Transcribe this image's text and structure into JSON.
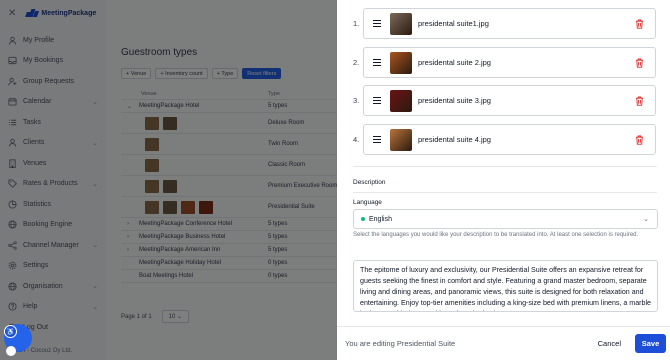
{
  "app": {
    "brand": "MeetingPackage",
    "close_icon": "close-icon"
  },
  "sidebar": {
    "items": [
      {
        "label": "My Profile",
        "icon": "user-icon",
        "expandable": false
      },
      {
        "label": "My Bookings",
        "icon": "inbox-icon",
        "expandable": false
      },
      {
        "label": "Group Requests",
        "icon": "add-user-icon",
        "expandable": false
      },
      {
        "label": "Calendar",
        "icon": "calendar-icon",
        "expandable": true
      },
      {
        "label": "Tasks",
        "icon": "list-icon",
        "expandable": false
      },
      {
        "label": "Clients",
        "icon": "user-icon",
        "expandable": true
      },
      {
        "label": "Venues",
        "icon": "building-icon",
        "expandable": false
      },
      {
        "label": "Rates & Products",
        "icon": "tag-icon",
        "expandable": true
      },
      {
        "label": "Statistics",
        "icon": "pie-chart-icon",
        "expandable": false
      },
      {
        "label": "Booking Engine",
        "icon": "globe-icon",
        "expandable": false
      },
      {
        "label": "Channel Manager",
        "icon": "share-icon",
        "expandable": true
      },
      {
        "label": "Settings",
        "icon": "gear-icon",
        "expandable": false
      },
      {
        "label": "Organisation",
        "icon": "globe-icon",
        "expandable": true
      },
      {
        "label": "Help",
        "icon": "help-icon",
        "expandable": true
      },
      {
        "label": "Log Out",
        "icon": "logout-icon",
        "expandable": false
      }
    ],
    "footer": "© 2024 - Cocouz Oy Ltd."
  },
  "main": {
    "title": "Guestroom types",
    "filters": [
      "+ Venue",
      "+ Inventory count",
      "+ Type"
    ],
    "reset_label": "Reset filters",
    "columns": [
      "Venue",
      "Type"
    ],
    "rows": [
      {
        "venue": "MeetingPackage Hotel",
        "type": "5 types",
        "expanded": true,
        "chev": "⌄"
      },
      {
        "venue": "",
        "type": "Deluxe Room",
        "thumbs": 2
      },
      {
        "venue": "",
        "type": "Twin Room",
        "thumbs": 1
      },
      {
        "venue": "",
        "type": "Classic Room",
        "thumbs": 1
      },
      {
        "venue": "",
        "type": "Premium Executive Room",
        "thumbs": 2
      },
      {
        "venue": "",
        "type": "Presidential Suite",
        "thumbs": 4
      },
      {
        "venue": "MeetingPackage Conference Hotel",
        "type": "5 types",
        "chev": "›"
      },
      {
        "venue": "MeetingPackage Business Hotel",
        "type": "5 types",
        "chev": "›"
      },
      {
        "venue": "MeetingPackage American Inn",
        "type": "5 types",
        "chev": "›"
      },
      {
        "venue": "MeetingPackage Holiday Hotel",
        "type": "0 types",
        "chev": ""
      },
      {
        "venue": "Boat Meetings Hotel",
        "type": "0 types",
        "chev": ""
      }
    ],
    "pager": {
      "label": "Page 1 of 1",
      "page_size": "10"
    }
  },
  "drawer": {
    "images": [
      {
        "num": "1.",
        "name": "presidental suite1.jpg",
        "color": "#7c6a5a"
      },
      {
        "num": "2.",
        "name": "presidental suite 2.jpg",
        "color": "#a8561f"
      },
      {
        "num": "3.",
        "name": "presidental suite 3.jpg",
        "color": "#6b1414"
      },
      {
        "num": "4.",
        "name": "presidental suite 4.jpg",
        "color": "#b8743a"
      }
    ],
    "description_heading": "Description",
    "language_label": "Language",
    "language_value": "English",
    "language_helper": "Select the languages you would like your description to be translated into. At least one selection is required.",
    "description_text": "The epitome of luxury and exclusivity, our Presidential Suite offers an expansive retreat for guests seeking the finest in comfort and style. Featuring a grand master bedroom, separate living and dining areas, and panoramic views, this suite is designed for both relaxation and entertaining. Enjoy top-tier amenities including a king-size bed with premium linens, a marble bathroom with deep soaking tub and rain shower.",
    "footer_text": "You are editing Presidential Suite",
    "cancel_label": "Cancel",
    "save_label": "Save"
  },
  "colors": {
    "primary": "#1d4ed8",
    "danger": "#dc2626",
    "success": "#10b981"
  }
}
